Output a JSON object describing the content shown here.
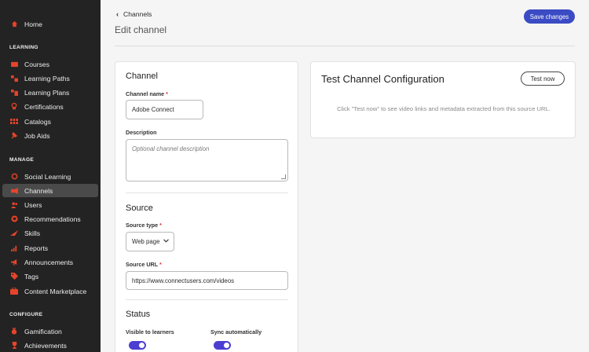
{
  "sidebar": {
    "home": {
      "label": "Home",
      "icon": "home-icon"
    },
    "sections": {
      "learning": "LEARNING",
      "manage": "MANAGE",
      "configure": "CONFIGURE"
    },
    "learning_items": [
      {
        "label": "Courses",
        "icon": "courses-icon"
      },
      {
        "label": "Learning Paths",
        "icon": "learning-paths-icon"
      },
      {
        "label": "Learning Plans",
        "icon": "learning-plans-icon"
      },
      {
        "label": "Certifications",
        "icon": "certifications-icon"
      },
      {
        "label": "Catalogs",
        "icon": "catalogs-icon"
      },
      {
        "label": "Job Aids",
        "icon": "job-aids-icon"
      }
    ],
    "manage_items": [
      {
        "label": "Social Learning",
        "icon": "social-learning-icon"
      },
      {
        "label": "Channels",
        "icon": "channels-icon",
        "active": true
      },
      {
        "label": "Users",
        "icon": "users-icon"
      },
      {
        "label": "Recommendations",
        "icon": "recommendations-icon"
      },
      {
        "label": "Skills",
        "icon": "skills-icon"
      },
      {
        "label": "Reports",
        "icon": "reports-icon"
      },
      {
        "label": "Announcements",
        "icon": "announcements-icon"
      },
      {
        "label": "Tags",
        "icon": "tags-icon"
      },
      {
        "label": "Content Marketplace",
        "icon": "content-marketplace-icon"
      }
    ],
    "configure_items": [
      {
        "label": "Gamification",
        "icon": "gamification-icon"
      },
      {
        "label": "Achievements",
        "icon": "achievements-icon"
      }
    ],
    "accent_color": "#e5442b"
  },
  "header": {
    "back_label": "Channels",
    "title": "Edit channel",
    "save_label": "Save changes"
  },
  "channel": {
    "section_title": "Channel",
    "name_label": "Channel name",
    "name_value": "Adobe Connect",
    "description_label": "Description",
    "description_placeholder": "Optional channel description"
  },
  "source": {
    "section_title": "Source",
    "type_label": "Source type",
    "type_value": "Web page",
    "url_label": "Source URL",
    "url_value": "https://www.connectusers.com/videos"
  },
  "status": {
    "section_title": "Status",
    "visible_label": "Visible to learners",
    "visible_on": true,
    "sync_label": "Sync automatically",
    "sync_on": true
  },
  "test_panel": {
    "title": "Test Channel Configuration",
    "button_label": "Test now",
    "hint": "Click \"Test now\" to see video links and metadata extracted from this source URL."
  },
  "required_marker": "*",
  "colors": {
    "primary": "#3b4bc4",
    "toggle": "#4b3fd1",
    "sidebar_bg": "#232323"
  }
}
